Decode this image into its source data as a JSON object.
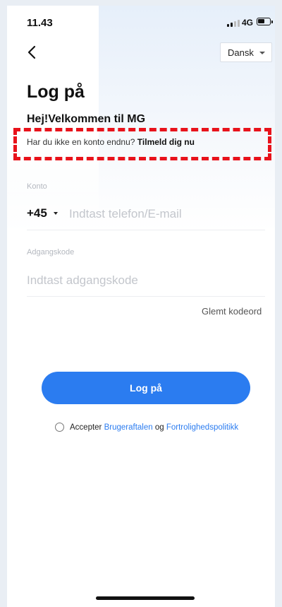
{
  "status_bar": {
    "time": "11.43",
    "network": "4G"
  },
  "header": {
    "language": "Dansk"
  },
  "title": "Log på",
  "welcome": "Hej!Velkommen til MG",
  "signup": {
    "prompt": "Har du ikke en konto endnu?",
    "link": "Tilmeld dig nu"
  },
  "account": {
    "label": "Konto",
    "country_code": "+45",
    "placeholder": "Indtast telefon/E-mail",
    "value": ""
  },
  "password": {
    "label": "Adgangskode",
    "placeholder": "Indtast adgangskode",
    "value": ""
  },
  "forgot_password": "Glemt kodeord",
  "login_button": "Log på",
  "terms": {
    "prefix": "Accepter",
    "user_agreement": "Brugeraftalen",
    "and": "og",
    "privacy_policy": "Fortrolighedspolitikk",
    "checked": false
  },
  "colors": {
    "accent": "#2b7cf0",
    "highlight": "#e8121b"
  }
}
